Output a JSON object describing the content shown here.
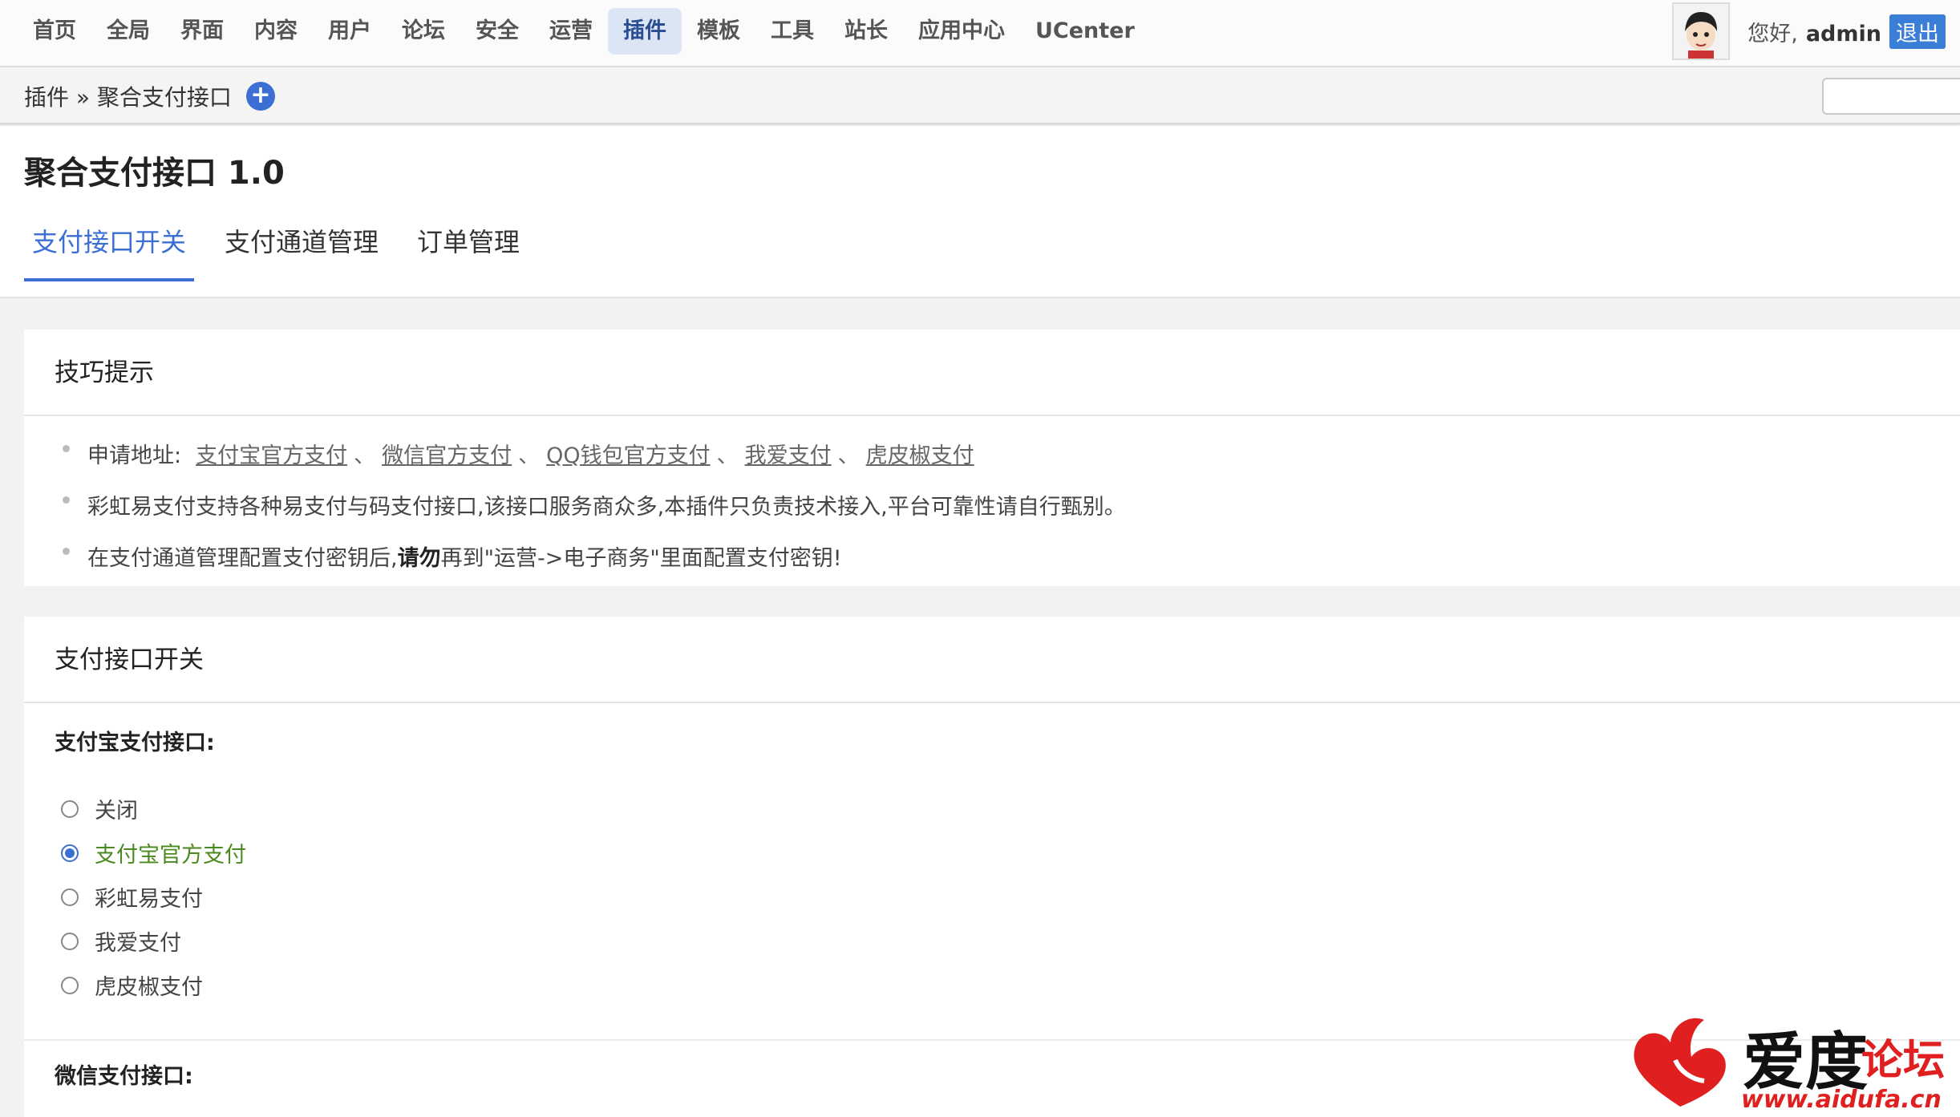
{
  "nav": {
    "items": [
      {
        "label": "首页"
      },
      {
        "label": "全局"
      },
      {
        "label": "界面"
      },
      {
        "label": "内容"
      },
      {
        "label": "用户"
      },
      {
        "label": "论坛"
      },
      {
        "label": "安全"
      },
      {
        "label": "运营"
      },
      {
        "label": "插件",
        "active": true
      },
      {
        "label": "模板"
      },
      {
        "label": "工具"
      },
      {
        "label": "站长"
      },
      {
        "label": "应用中心"
      },
      {
        "label": "UCenter"
      }
    ],
    "greeting": "您好,",
    "username": "admin",
    "logout_label": "退出"
  },
  "breadcrumb": {
    "text": "插件 » 聚合支付接口",
    "add_icon": "plus-circle-icon"
  },
  "page": {
    "title": "聚合支付接口 1.0",
    "tabs": [
      {
        "label": "支付接口开关",
        "active": true
      },
      {
        "label": "支付通道管理"
      },
      {
        "label": "订单管理"
      }
    ]
  },
  "tips_panel": {
    "title": "技巧提示",
    "apply_prefix": "申请地址:",
    "apply_links": [
      "支付宝官方支付",
      "微信官方支付",
      "QQ钱包官方支付",
      "我爱支付",
      "虎皮椒支付"
    ],
    "separator": "、",
    "tip2": "彩虹易支付支持各种易支付与码支付接口,该接口服务商众多,本插件只负责技术接入,平台可靠性请自行甄别。",
    "tip3_before": "在支付通道管理配置支付密钥后,",
    "tip3_bold": "请勿",
    "tip3_after": "再到\"运营->电子商务\"里面配置支付密钥!"
  },
  "switch_panel": {
    "title": "支付接口开关",
    "alipay_label": "支付宝支付接口:",
    "alipay_options": [
      {
        "label": "关闭",
        "checked": false
      },
      {
        "label": "支付宝官方支付",
        "checked": true
      },
      {
        "label": "彩虹易支付",
        "checked": false
      },
      {
        "label": "我爱支付",
        "checked": false
      },
      {
        "label": "虎皮椒支付",
        "checked": false
      }
    ],
    "wechat_label": "微信支付接口:"
  },
  "watermark": {
    "text_main": "爱度",
    "text_sub": "论坛",
    "url": "www.aidufa.cn"
  },
  "colors": {
    "accent": "#3b6fd4",
    "selected_text": "#4a8a1f",
    "logout_bg": "#3b7ed8",
    "watermark_red": "#e02020"
  }
}
